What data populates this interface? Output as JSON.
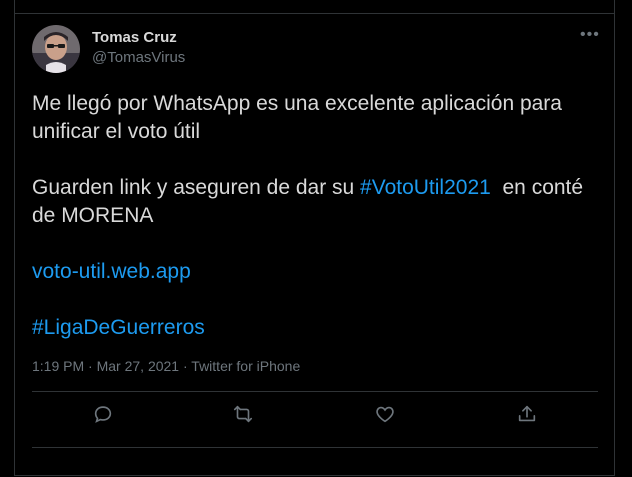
{
  "tweet": {
    "author_name": "Tomas Cruz",
    "author_handle": "@TomasVirus",
    "more_icon": "ellipsis-icon",
    "line1": "Me llegó por WhatsApp es una excelente aplicación para unificar el voto útil",
    "line2_prefix": "Guarden link y aseguren de dar su ",
    "line2_hashtag": "#VotoUtil2021",
    "line2_suffix": "  en conté de MORENA",
    "link": "voto-util.web.app",
    "hashtag2": "#LigaDeGuerreros",
    "time": "1:19 PM",
    "date": "Mar 27, 2021",
    "source": "Twitter for iPhone",
    "sep": "·"
  },
  "actions": [
    "reply-icon",
    "retweet-icon",
    "like-icon",
    "share-icon"
  ],
  "colors": {
    "background": "#000000",
    "link": "#1d9bf0",
    "muted": "#6e767d",
    "border": "#2f3336"
  }
}
